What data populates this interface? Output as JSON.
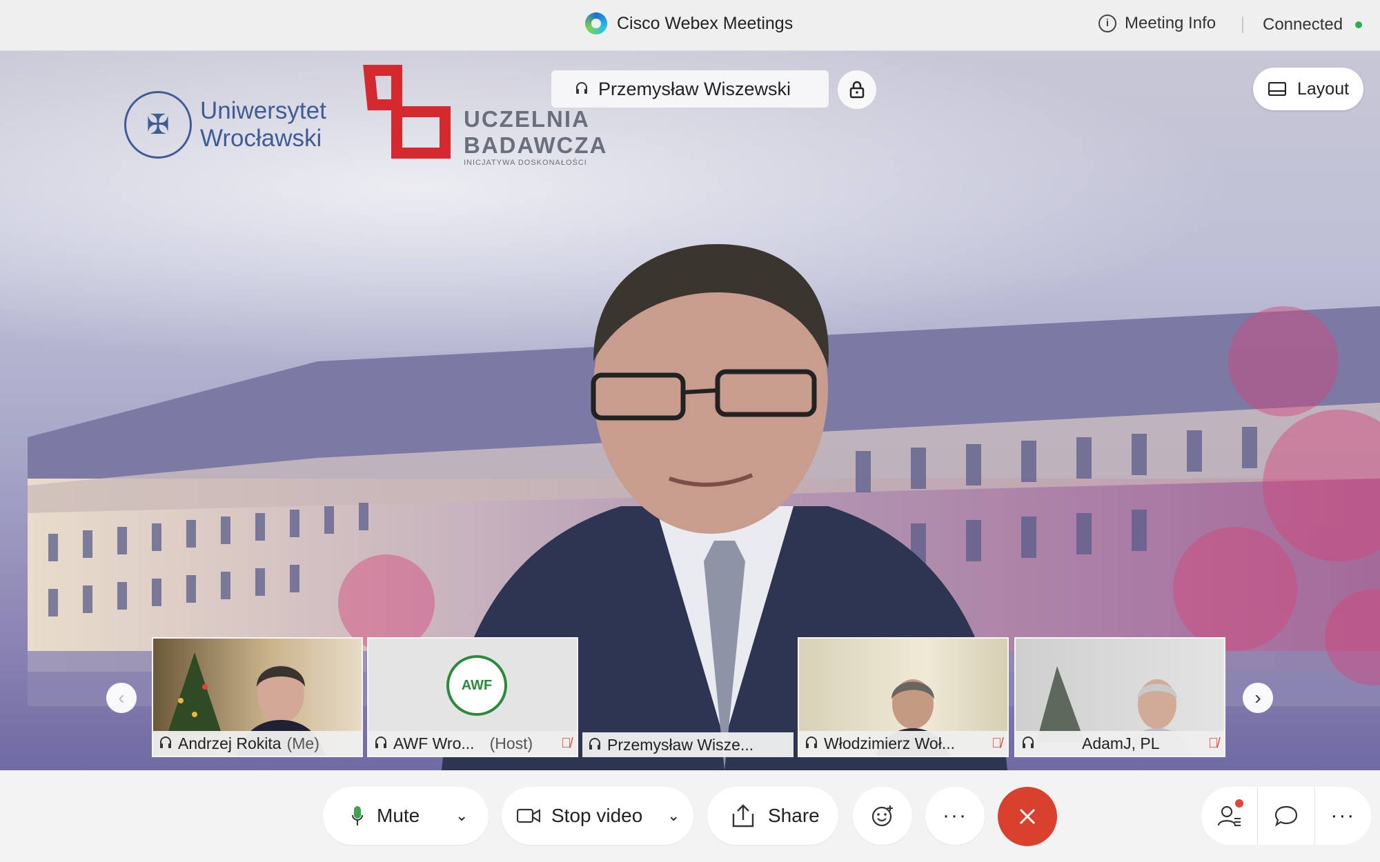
{
  "titlebar": {
    "app_title": "Cisco Webex Meetings",
    "meeting_info": "Meeting Info",
    "connection_status": "Connected",
    "status_color": "#2fae4e"
  },
  "video": {
    "active_speaker": "Przemysław Wiszewski",
    "layout_label": "Layout",
    "logos": {
      "uw_line1": "Uniwersytet",
      "uw_line2": "Wrocławski",
      "ub_line1": "UCZELNIA",
      "ub_line2": "BADAWCZA",
      "ub_line3": "INICJATYWA DOSKONAŁOŚCI"
    }
  },
  "filmstrip": [
    {
      "name": "Andrzej Rokita",
      "tag": "(Me)",
      "muted": false
    },
    {
      "name": "AWF Wro...",
      "tag": "(Host)",
      "muted": true,
      "logo_text": "AWF"
    },
    {
      "name": "Przemysław Wisze...",
      "tag": "",
      "muted": false
    },
    {
      "name": "Włodzimierz Woł...",
      "tag": "",
      "muted": true
    },
    {
      "name": "AdamJ, PL",
      "tag": "",
      "muted": true
    }
  ],
  "controls": {
    "mute_label": "Mute",
    "stop_video_label": "Stop video",
    "share_label": "Share",
    "end_color": "#d9412f"
  },
  "icons": [
    "webex-logo",
    "info-icon",
    "headset-icon",
    "lock-icon",
    "layout-icon",
    "microphone-icon",
    "camera-icon",
    "share-icon",
    "reactions-icon",
    "more-icon",
    "end-call-icon",
    "participants-icon",
    "chat-icon"
  ]
}
